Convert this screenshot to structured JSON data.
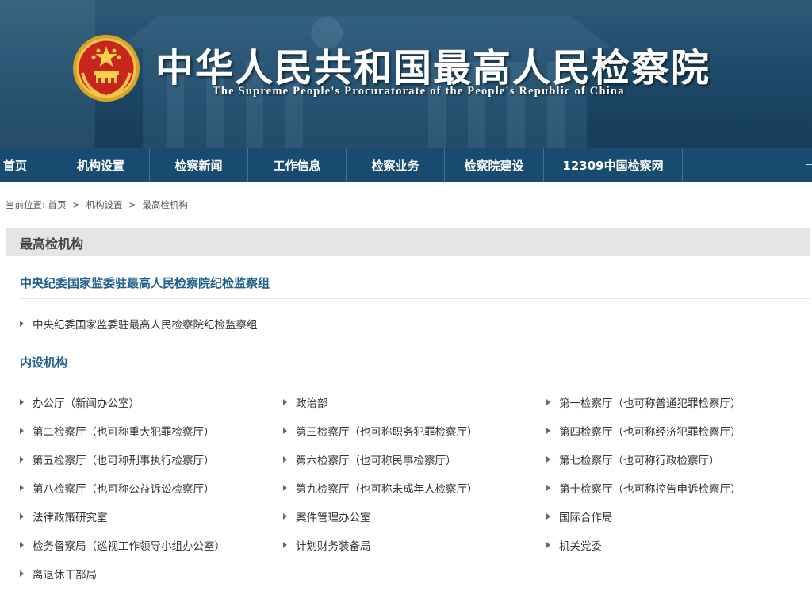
{
  "header": {
    "title": "中华人民共和国最高人民检察院",
    "subtitle": "The Supreme People's Procuratorate of the People's Republic of China"
  },
  "nav": [
    {
      "label": "首页"
    },
    {
      "label": "机构设置"
    },
    {
      "label": "检察新闻"
    },
    {
      "label": "工作信息"
    },
    {
      "label": "检察业务"
    },
    {
      "label": "检察院建设"
    },
    {
      "label": "12309中国检察网"
    }
  ],
  "breadcrumb": {
    "prefix": "当前位置:",
    "items": [
      "首页",
      "机构设置",
      "最高检机构"
    ],
    "separator": ">"
  },
  "panel": {
    "title": "最高检机构"
  },
  "discipline": {
    "title": "中央纪委国家监委驻最高人民检察院纪检监察组",
    "items": [
      "中央纪委国家监委驻最高人民检察院纪检监察组"
    ]
  },
  "internal": {
    "title": "内设机构",
    "items": [
      "办公厅（新闻办公室）",
      "政治部",
      "第一检察厅（也可称普通犯罪检察厅）",
      "第二检察厅（也可称重大犯罪检察厅）",
      "第三检察厅（也可称职务犯罪检察厅）",
      "第四检察厅（也可称经济犯罪检察厅）",
      "第五检察厅（也可称刑事执行检察厅）",
      "第六检察厅（也可称民事检察厅）",
      "第七检察厅（也可称行政检察厅）",
      "第八检察厅（也可称公益诉讼检察厅）",
      "第九检察厅（也可称未成年人检察厅）",
      "第十检察厅（也可称控告申诉检察厅）",
      "法律政策研究室",
      "案件管理办公室",
      "国际合作局",
      "检务督察局（巡视工作领导小组办公室）",
      "计划财务装备局",
      "机关党委",
      "离退休干部局"
    ]
  },
  "colors": {
    "banner": "#1f4a69",
    "nav": "#174b6f",
    "section_title": "#1f5f8c",
    "panel_head": "#e5e5e5"
  }
}
